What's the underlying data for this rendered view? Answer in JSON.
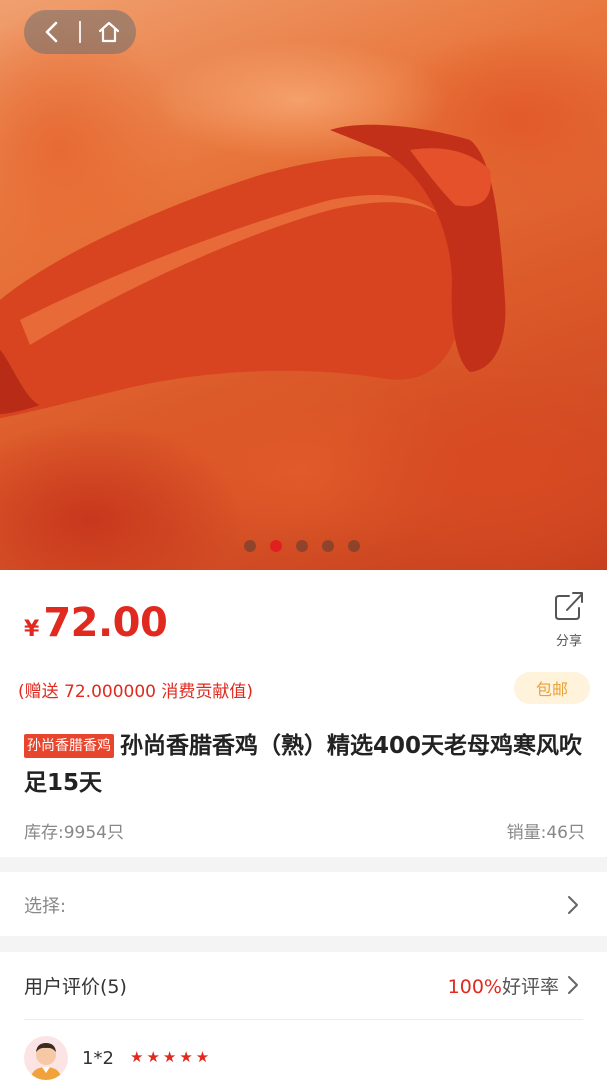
{
  "nav": {
    "back_icon": "chevron-left-icon",
    "home_icon": "home-icon"
  },
  "carousel": {
    "slide_count": 5,
    "active_index": 1
  },
  "product": {
    "currency": "¥",
    "price": "72.00",
    "share_label": "分享",
    "bonus_text": "(赠送 72.000000 消费贡献值)",
    "shipping_badge": "包邮",
    "shop_tag": "孙尚香腊香鸡",
    "title": "孙尚香腊香鸡（熟）精选400天老母鸡寒风吹足15天",
    "stock": "库存:9954只",
    "sales": "销量:46只"
  },
  "select_row": {
    "label": "选择:"
  },
  "reviews": {
    "header": "用户评价(5)",
    "positive_pct": "100%",
    "positive_label": "好评率",
    "items": [
      {
        "user": "1*2",
        "stars": "★★★★★"
      }
    ]
  },
  "colors": {
    "accent": "#e02a20",
    "shipping_bg": "#fff3dc",
    "shipping_fg": "#e8a23a"
  }
}
